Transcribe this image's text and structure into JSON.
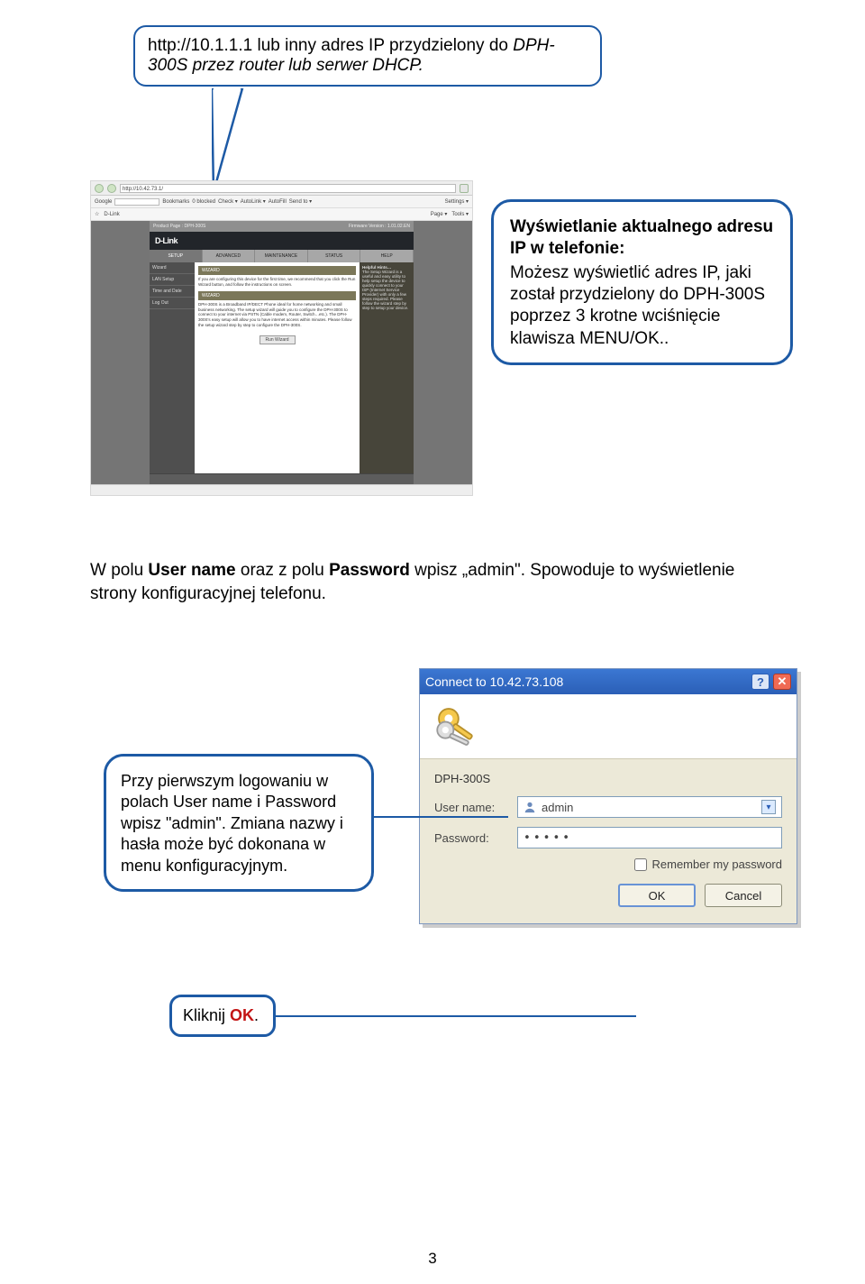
{
  "speech_top": {
    "url": "http://10.1.1.1",
    "rest": " lub inny adres IP przydzielony do ",
    "device": "DPH-300S",
    "rest2": " przez router lub serwer  DHCP."
  },
  "bubble_right": {
    "line1": "Wyświetlanie aktualnego adresu IP w telefonie:",
    "line2": "Możesz wyświetlić adres IP, jaki został przydzielony do DPH-300S poprzez 3 krotne wciśnięcie klawisza MENU/OK.."
  },
  "browser": {
    "url": "http://10.42.73.1/",
    "google_label": "Google",
    "bookmarks": "Bookmarks",
    "checked": "0 blocked",
    "check": "Check ▾",
    "autolink": "AutoLink ▾",
    "autofill": "AutoFill",
    "sendto": "Send to ▾",
    "settings": "Settings ▾",
    "page": "Page ▾",
    "tools": "Tools ▾",
    "title_left": "Product Page : DPH-300S",
    "title_right_label": "Firmware Version :",
    "title_right_value": "1.01.02.EN",
    "logo": "D-Link",
    "tabs": {
      "setup": "SETUP",
      "advanced": "ADVANCED",
      "maint": "MAINTENANCE",
      "status": "STATUS",
      "help": "HELP"
    },
    "side": {
      "wizard": "Wizard",
      "lan": "LAN Setup",
      "time": "Time and Date",
      "logout": "Log Out"
    },
    "wizard_header": "WIZARD",
    "wizard_text1": "If you are configuring this device for the first time, we recommend that you click the Run Wizard button, and follow the instructions on screen.",
    "wizard_text2": "DPH-300S is a Broadband IP/DECT Phone ideal for home networking and small business networking. The setup wizard will guide you to configure the DPH-300S to connect to your internet via PSTN (Cable modem, Router, Switch…etc.). The DPH-300S's easy setup will allow you to have internet access within minutes. Please follow the setup wizard step by step to configure the DPH-300S.",
    "run_wizard": "Run Wizard",
    "help_header": "Helpful Hints…",
    "help_text": "The Setup Wizard is a useful and easy utility to help setup the device to quickly connect to your ISP (Internet Service Provider) with only a few steps required. Please follow the wizard step by step to setup your device."
  },
  "mid_para": {
    "t1": "W polu ",
    "b1": "User name",
    "t2": " oraz z polu ",
    "b2": "Password",
    "t3": " wpisz „admin\". Spowoduje to wyświetlenie strony konfiguracyjnej telefonu."
  },
  "login": {
    "title": "Connect to 10.42.73.108",
    "device": "DPH-300S",
    "user_label": "User name:",
    "user_value": "admin",
    "pass_label": "Password:",
    "pass_value": "•••••",
    "remember": "Remember my password",
    "ok": "OK",
    "cancel": "Cancel"
  },
  "bubble_left": {
    "text": "Przy pierwszym logowaniu w polach User name i Password wpisz \"admin\". Zmiana nazwy i hasła może być dokonana w menu konfiguracyjnym."
  },
  "bubble_ok": {
    "t1": "Kliknij ",
    "ok": "OK",
    "t2": "."
  },
  "page_number": "3"
}
